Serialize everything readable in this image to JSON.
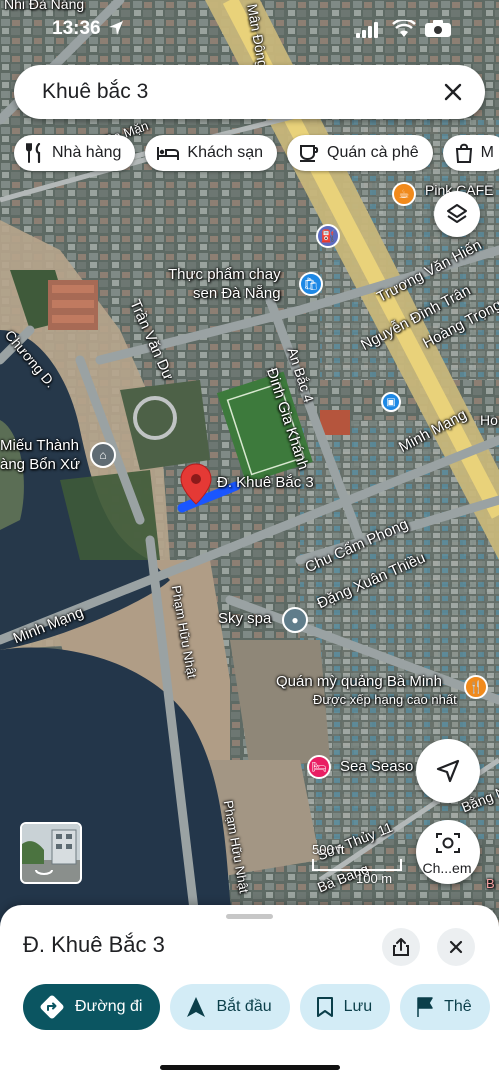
{
  "status_bar": {
    "time": "13:36",
    "top_left_label": "Nhi Đà Nẵng"
  },
  "search": {
    "query": "Khuê bắc 3"
  },
  "chips": [
    {
      "label": "Nhà hàng",
      "icon": "fork-knife-icon"
    },
    {
      "label": "Khách sạn",
      "icon": "bed-icon"
    },
    {
      "label": "Quán cà phê",
      "icon": "coffee-cup-icon"
    },
    {
      "label": "M",
      "icon": "shopping-bag-icon"
    }
  ],
  "map_labels": {
    "main_dong": "Mân Đông",
    "da_mang": "Đa Mặn",
    "pink_cafe": "Pink CAFE",
    "truong_van_hien": "Trương Văn Hiến",
    "thuc_pham_chay_1": "Thực phẩm chay",
    "thuc_pham_chay_2": "sen Đà Nẵng",
    "nguyen_dinh_tran": "Nguyễn Đình Trân",
    "hoang_trong": "Hoàng Trọng",
    "tran_van_dan": "Trần Văn Dư",
    "chuong_d": "Chương D.",
    "an_bac_4": "An Bắc 4",
    "dinh_gia_khanh": "Đinh Gia Khánh",
    "mieu_thanh_1": "Miếu Thành",
    "mieu_thanh_2": "àng Bổn Xứ",
    "minh_mang_1": "Minh Mạng",
    "khue_bac_3_pin": "Đ. Khuê Bắc 3",
    "chu_cam_phong": "Chu Cẩm Phong",
    "dang_xuan_thieu": "Đặng Xuân Thiều",
    "minh_mang_2": "Minh Mạng",
    "pham_huu_nhat_1": "Phạm Hữu Nhật",
    "sky_spa": "Sky spa",
    "quan_my_quang": "Quán mỳ quảng Bà Minh",
    "duoc_xep_hang": "Được xếp hạng cao nhất",
    "sea_season": "Sea Seaso",
    "pham_huu_nhat_2": "Phạm Hữu Nhật",
    "son_thuy_11": "Sơn Thủy 11",
    "ba_bang": "Bà Bang",
    "ba_bang_2": "Bằng N",
    "ho": "Ho",
    "b_right": "B"
  },
  "scale": {
    "feet": "500 ft",
    "meters": "100 m"
  },
  "fabs": {
    "chxem": "Ch...em"
  },
  "sheet": {
    "title": "Đ. Khuê Bắc 3",
    "actions": [
      {
        "label": "Đường đi",
        "icon": "directions-icon",
        "primary": true
      },
      {
        "label": "Bắt đầu",
        "icon": "navigation-arrow-icon"
      },
      {
        "label": "Lưu",
        "icon": "bookmark-icon"
      },
      {
        "label": "Thê",
        "icon": "flag-icon"
      }
    ]
  },
  "colors": {
    "accent": "#0b5561",
    "chip_bg": "#d3ecf6",
    "pin_red": "#e53935",
    "route_blue": "#1a56ff"
  }
}
